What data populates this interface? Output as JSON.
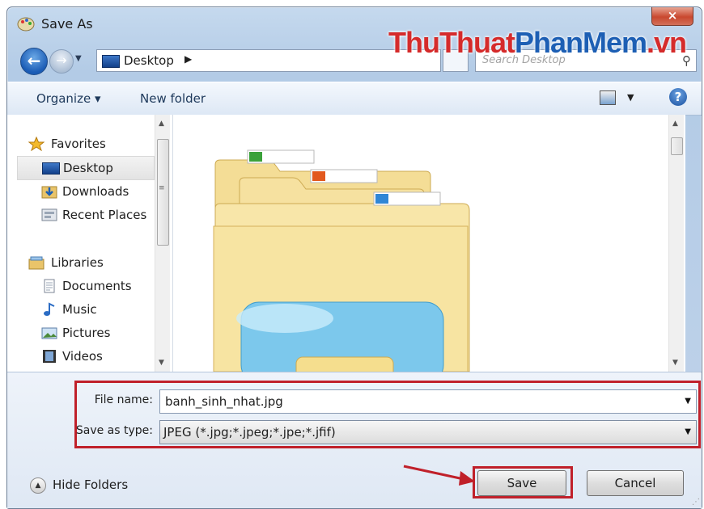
{
  "window": {
    "title": "Save As",
    "close_glyph": "×"
  },
  "nav": {
    "back_glyph": "←",
    "forward_glyph": "→",
    "history_glyph": "▼",
    "address": "Desktop",
    "address_chevron": "▶",
    "search_placeholder": "Search Desktop",
    "search_glyph": "⚲"
  },
  "watermark": {
    "part1": "ThuThuat",
    "part2": "PhanMem",
    "part3": ".vn"
  },
  "toolbar": {
    "organize": "Organize ▾",
    "new_folder": "New folder",
    "view_arrow": "▼",
    "help_glyph": "?"
  },
  "sidebar": {
    "favorites": "Favorites",
    "items_favorites": [
      "Desktop",
      "Downloads",
      "Recent Places"
    ],
    "libraries": "Libraries",
    "items_libraries": [
      "Documents",
      "Music",
      "Pictures",
      "Videos"
    ],
    "grip": "≡",
    "up": "▲",
    "down": "▼"
  },
  "form": {
    "file_name_label": "File name:",
    "file_name_value": "banh_sinh_nhat.jpg",
    "save_type_label": "Save as type:",
    "save_type_value": "JPEG (*.jpg;*.jpeg;*.jpe;*.jfif)",
    "dd_glyph": "▼"
  },
  "footer": {
    "hide_folders": "Hide Folders",
    "hide_glyph": "▲",
    "save": "Save",
    "cancel": "Cancel",
    "grip": "⋰"
  },
  "colors": {
    "highlight": "#c0202a",
    "accent": "#1d5fb4"
  }
}
